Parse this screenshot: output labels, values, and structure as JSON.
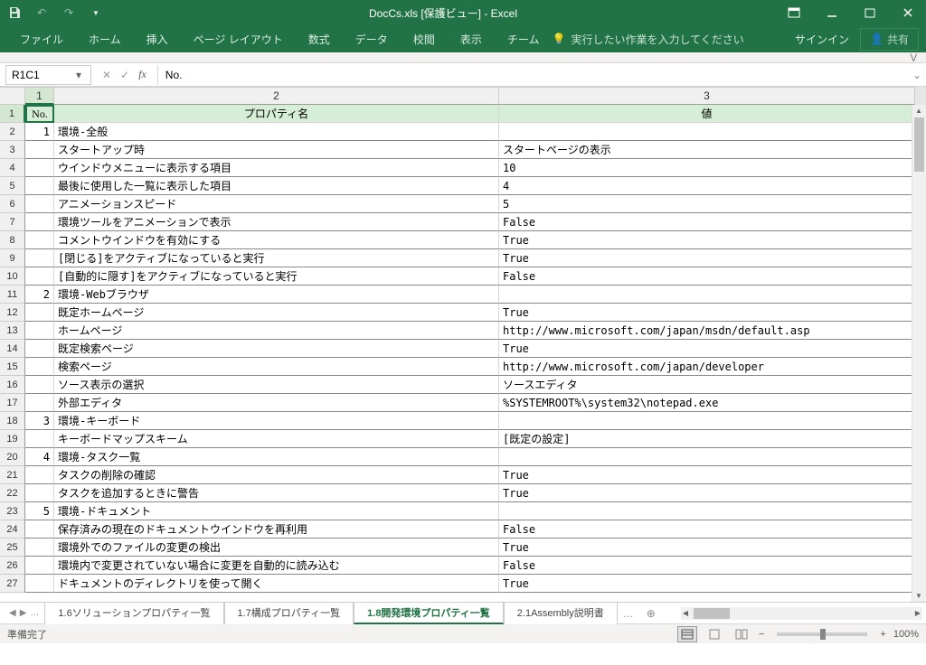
{
  "titlebar": {
    "title": "DocCs.xls [保護ビュー] - Excel"
  },
  "ribbon": {
    "tabs": [
      "ファイル",
      "ホーム",
      "挿入",
      "ページ レイアウト",
      "数式",
      "データ",
      "校閲",
      "表示",
      "チーム"
    ],
    "tellme": "実行したい作業を入力してください",
    "signin": "サインイン",
    "share": "共有"
  },
  "namebox": {
    "value": "R1C1"
  },
  "formula": {
    "value": "No."
  },
  "headers": {
    "no": "No.",
    "prop": "プロパティ名",
    "val": "値"
  },
  "rows": [
    {
      "n": "1",
      "no": "1",
      "p": "環境-全般",
      "v": ""
    },
    {
      "n": "2",
      "no": "",
      "p": "スタートアップ時",
      "v": "スタートページの表示"
    },
    {
      "n": "3",
      "no": "",
      "p": "ウインドウメニューに表示する項目",
      "v": "10"
    },
    {
      "n": "4",
      "no": "",
      "p": "最後に使用した一覧に表示した項目",
      "v": "4"
    },
    {
      "n": "5",
      "no": "",
      "p": "アニメーションスピード",
      "v": "5"
    },
    {
      "n": "6",
      "no": "",
      "p": "環境ツールをアニメーションで表示",
      "v": "False"
    },
    {
      "n": "7",
      "no": "",
      "p": "コメントウインドウを有効にする",
      "v": "True"
    },
    {
      "n": "8",
      "no": "",
      "p": "[閉じる]をアクティブになっていると実行",
      "v": "True"
    },
    {
      "n": "9",
      "no": "",
      "p": "[自動的に隠す]をアクティブになっていると実行",
      "v": "False"
    },
    {
      "n": "10",
      "no": "2",
      "p": "環境-Webブラウザ",
      "v": ""
    },
    {
      "n": "11",
      "no": "",
      "p": "既定ホームページ",
      "v": "True"
    },
    {
      "n": "12",
      "no": "",
      "p": "ホームページ",
      "v": "http://www.microsoft.com/japan/msdn/default.asp"
    },
    {
      "n": "13",
      "no": "",
      "p": "既定検索ページ",
      "v": "True"
    },
    {
      "n": "14",
      "no": "",
      "p": "検索ページ",
      "v": "http://www.microsoft.com/japan/developer"
    },
    {
      "n": "15",
      "no": "",
      "p": "ソース表示の選択",
      "v": "ソースエディタ"
    },
    {
      "n": "16",
      "no": "",
      "p": "外部エディタ",
      "v": "%SYSTEMROOT%\\system32\\notepad.exe"
    },
    {
      "n": "17",
      "no": "3",
      "p": "環境-キーボード",
      "v": ""
    },
    {
      "n": "18",
      "no": "",
      "p": "キーボードマップスキーム",
      "v": "[既定の設定]"
    },
    {
      "n": "19",
      "no": "4",
      "p": "環境-タスク一覧",
      "v": ""
    },
    {
      "n": "20",
      "no": "",
      "p": "タスクの削除の確認",
      "v": "True"
    },
    {
      "n": "21",
      "no": "",
      "p": "タスクを追加するときに警告",
      "v": "True"
    },
    {
      "n": "22",
      "no": "5",
      "p": "環境-ドキュメント",
      "v": ""
    },
    {
      "n": "23",
      "no": "",
      "p": "保存済みの現在のドキュメントウインドウを再利用",
      "v": "False"
    },
    {
      "n": "24",
      "no": "",
      "p": "環境外でのファイルの変更の検出",
      "v": "True"
    },
    {
      "n": "25",
      "no": "",
      "p": "環境内で変更されていない場合に変更を自動的に読み込む",
      "v": "False"
    },
    {
      "n": "26",
      "no": "",
      "p": "ドキュメントのディレクトリを使って開く",
      "v": "True"
    }
  ],
  "sheets": {
    "tabs": [
      "1.6ソリューションプロパティ一覧",
      "1.7構成プロパティ一覧",
      "1.8開発環境プロパティ一覧",
      "2.1Assembly説明書"
    ],
    "active": 2
  },
  "status": {
    "ready": "準備完了",
    "zoom": "100%"
  },
  "colHeads": {
    "c1": "1",
    "c2": "2",
    "c3": "3"
  },
  "chart_data": {
    "type": "table",
    "title": "1.8開発環境プロパティ一覧",
    "columns": [
      "No.",
      "プロパティ名",
      "値"
    ],
    "rows": [
      [
        "1",
        "環境-全般",
        ""
      ],
      [
        "",
        "スタートアップ時",
        "スタートページの表示"
      ],
      [
        "",
        "ウインドウメニューに表示する項目",
        "10"
      ],
      [
        "",
        "最後に使用した一覧に表示した項目",
        "4"
      ],
      [
        "",
        "アニメーションスピード",
        "5"
      ],
      [
        "",
        "環境ツールをアニメーションで表示",
        "False"
      ],
      [
        "",
        "コメントウインドウを有効にする",
        "True"
      ],
      [
        "",
        "[閉じる]をアクティブになっていると実行",
        "True"
      ],
      [
        "",
        "[自動的に隠す]をアクティブになっていると実行",
        "False"
      ],
      [
        "2",
        "環境-Webブラウザ",
        ""
      ],
      [
        "",
        "既定ホームページ",
        "True"
      ],
      [
        "",
        "ホームページ",
        "http://www.microsoft.com/japan/msdn/default.asp"
      ],
      [
        "",
        "既定検索ページ",
        "True"
      ],
      [
        "",
        "検索ページ",
        "http://www.microsoft.com/japan/developer"
      ],
      [
        "",
        "ソース表示の選択",
        "ソースエディタ"
      ],
      [
        "",
        "外部エディタ",
        "%SYSTEMROOT%\\system32\\notepad.exe"
      ],
      [
        "3",
        "環境-キーボード",
        ""
      ],
      [
        "",
        "キーボードマップスキーム",
        "[既定の設定]"
      ],
      [
        "4",
        "環境-タスク一覧",
        ""
      ],
      [
        "",
        "タスクの削除の確認",
        "True"
      ],
      [
        "",
        "タスクを追加するときに警告",
        "True"
      ],
      [
        "5",
        "環境-ドキュメント",
        ""
      ],
      [
        "",
        "保存済みの現在のドキュメントウインドウを再利用",
        "False"
      ],
      [
        "",
        "環境外でのファイルの変更の検出",
        "True"
      ],
      [
        "",
        "環境内で変更されていない場合に変更を自動的に読み込む",
        "False"
      ],
      [
        "",
        "ドキュメントのディレクトリを使って開く",
        "True"
      ]
    ]
  }
}
